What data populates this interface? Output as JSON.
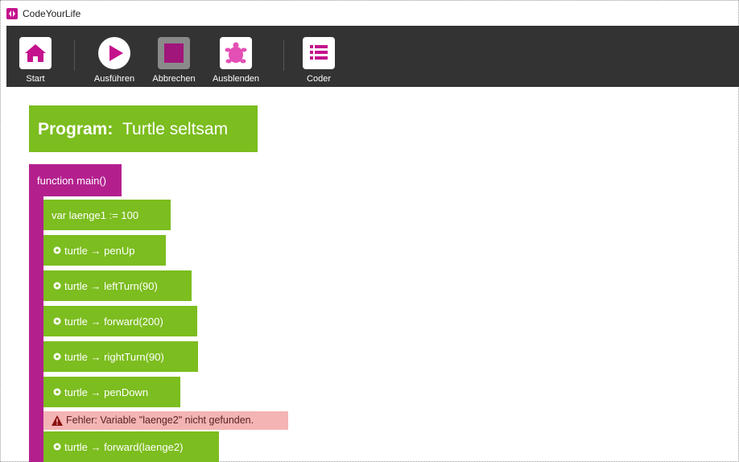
{
  "app": {
    "title": "CodeYourLife"
  },
  "toolbar": {
    "buttons": [
      {
        "label": "Start",
        "icon": "home-icon"
      },
      {
        "label": "Ausführen",
        "icon": "play-icon"
      },
      {
        "label": "Abbrechen",
        "icon": "stop-icon"
      },
      {
        "label": "Ausblenden",
        "icon": "turtle-icon"
      },
      {
        "label": "Coder",
        "icon": "list-icon"
      }
    ]
  },
  "program": {
    "label": "Program:",
    "name": "Turtle seltsam"
  },
  "function": {
    "header": "function main()"
  },
  "statements": [
    {
      "text": "var laenge1 := 100"
    },
    {
      "text": "turtle → penUp"
    },
    {
      "text": "turtle → leftTurn(90)"
    },
    {
      "text": "turtle → forward(200)"
    },
    {
      "text": "turtle → rightTurn(90)"
    },
    {
      "text": "turtle → penDown"
    },
    {
      "text": "turtle → forward(laenge2)"
    }
  ],
  "error": {
    "text": "Fehler: Variable \"laenge2\" nicht gefunden."
  },
  "colors": {
    "accent": "#c4128c",
    "block_green": "#7cbd1f",
    "function_magenta": "#b3208e",
    "toolbar_bg": "#333333",
    "error_bg": "#f4b4b4"
  }
}
